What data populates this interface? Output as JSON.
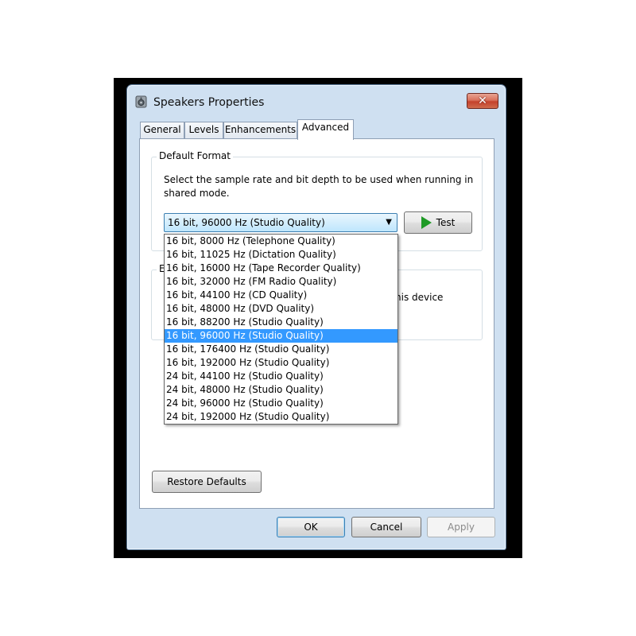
{
  "window": {
    "title": "Speakers Properties",
    "close_glyph": "✕"
  },
  "tabs": [
    {
      "label": "General",
      "active": false
    },
    {
      "label": "Levels",
      "active": false
    },
    {
      "label": "Enhancements",
      "active": false
    },
    {
      "label": "Advanced",
      "active": true
    }
  ],
  "default_format": {
    "legend": "Default Format",
    "description": "Select the sample rate and bit depth to be used when running in shared mode.",
    "selected_value": "16 bit, 96000 Hz (Studio Quality)",
    "test_label": "Test",
    "options": [
      "16 bit, 8000 Hz (Telephone Quality)",
      "16 bit, 11025 Hz (Dictation Quality)",
      "16 bit, 16000 Hz (Tape Recorder Quality)",
      "16 bit, 32000 Hz (FM Radio Quality)",
      "16 bit, 44100 Hz (CD Quality)",
      "16 bit, 48000 Hz (DVD Quality)",
      "16 bit, 88200 Hz (Studio Quality)",
      "16 bit, 96000 Hz (Studio Quality)",
      "16 bit, 176400 Hz (Studio Quality)",
      "16 bit, 192000 Hz (Studio Quality)",
      "24 bit, 44100 Hz (Studio Quality)",
      "24 bit, 48000 Hz (Studio Quality)",
      "24 bit, 96000 Hz (Studio Quality)",
      "24 bit, 192000 Hz (Studio Quality)"
    ],
    "selected_index": 7
  },
  "exclusive_mode": {
    "legend_partial": "E",
    "text_partial": "his device"
  },
  "buttons": {
    "restore_defaults": "Restore Defaults",
    "ok": "OK",
    "cancel": "Cancel",
    "apply": "Apply"
  },
  "colors": {
    "selection": "#3399ff",
    "play_icon": "#1f9a26",
    "close_button": "#c4412b"
  },
  "icons": {
    "window": "speaker-icon",
    "close": "close-icon",
    "test": "play-icon",
    "dropdown": "chevron-down-icon"
  }
}
